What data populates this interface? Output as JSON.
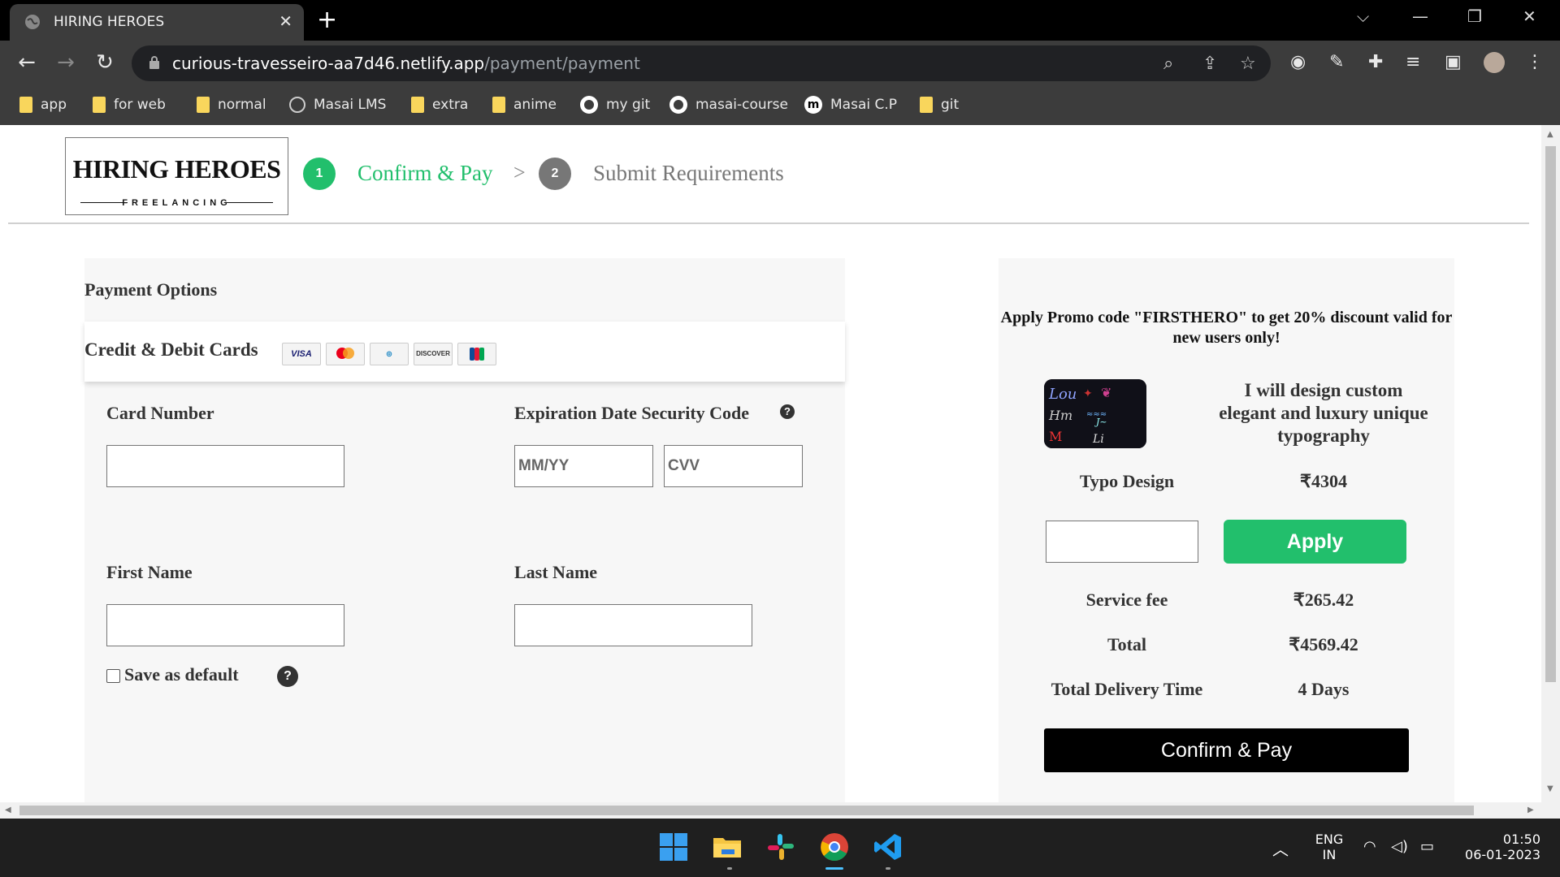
{
  "browser": {
    "tab_title": "HIRING HEROES",
    "tab_close": "✕",
    "new_tab": "+",
    "url_host": "curious-travesseiro-aa7d46.netlify.app",
    "url_path": "/payment/payment",
    "bookmarks": [
      "app",
      "for web",
      "normal",
      "Masai LMS",
      "extra",
      "anime",
      "my git",
      "masai-course",
      "Masai C.P",
      "git"
    ]
  },
  "header": {
    "logo_title": "HIRING HEROES",
    "logo_subtitle": "FREELANCING",
    "steps": [
      {
        "number": "1",
        "label": "Confirm & Pay",
        "color": "#22bf6c"
      },
      {
        "number": "2",
        "label": "Submit Requirements",
        "color": "#777777"
      }
    ],
    "step_separator": ">"
  },
  "payment": {
    "title": "Payment Options",
    "cards_title": "Credit & Debit Cards",
    "card_brands": [
      "VISA",
      "Mastercard",
      "Diners Club",
      "DISCOVER",
      "JCB"
    ],
    "card_number_label": "Card Number",
    "expiration_label": "Expiration Date Security Code",
    "expiry_placeholder": "MM/YY",
    "cvv_placeholder": "CVV",
    "first_name_label": "First Name",
    "last_name_label": "Last Name",
    "save_default_label": "Save as default",
    "help_glyph": "?"
  },
  "summary": {
    "promo_text": "Apply Promo code \"FIRSTHERO\" to get 20% discount valid for new users only!",
    "gig_title": "I will design custom elegant and luxury unique typography",
    "item_label": "Typo Design",
    "item_price": "₹4304",
    "apply_label": "Apply",
    "service_fee_label": "Service fee",
    "service_fee_value": "₹265.42",
    "total_label": "Total",
    "total_value": "₹4569.42",
    "delivery_label": "Total Delivery Time",
    "delivery_value": "4 Days",
    "confirm_label": "Confirm & Pay",
    "accent_color": "#22bf6c"
  },
  "taskbar": {
    "lang": "ENG",
    "region": "IN",
    "time": "01:50",
    "date": "06-01-2023"
  }
}
